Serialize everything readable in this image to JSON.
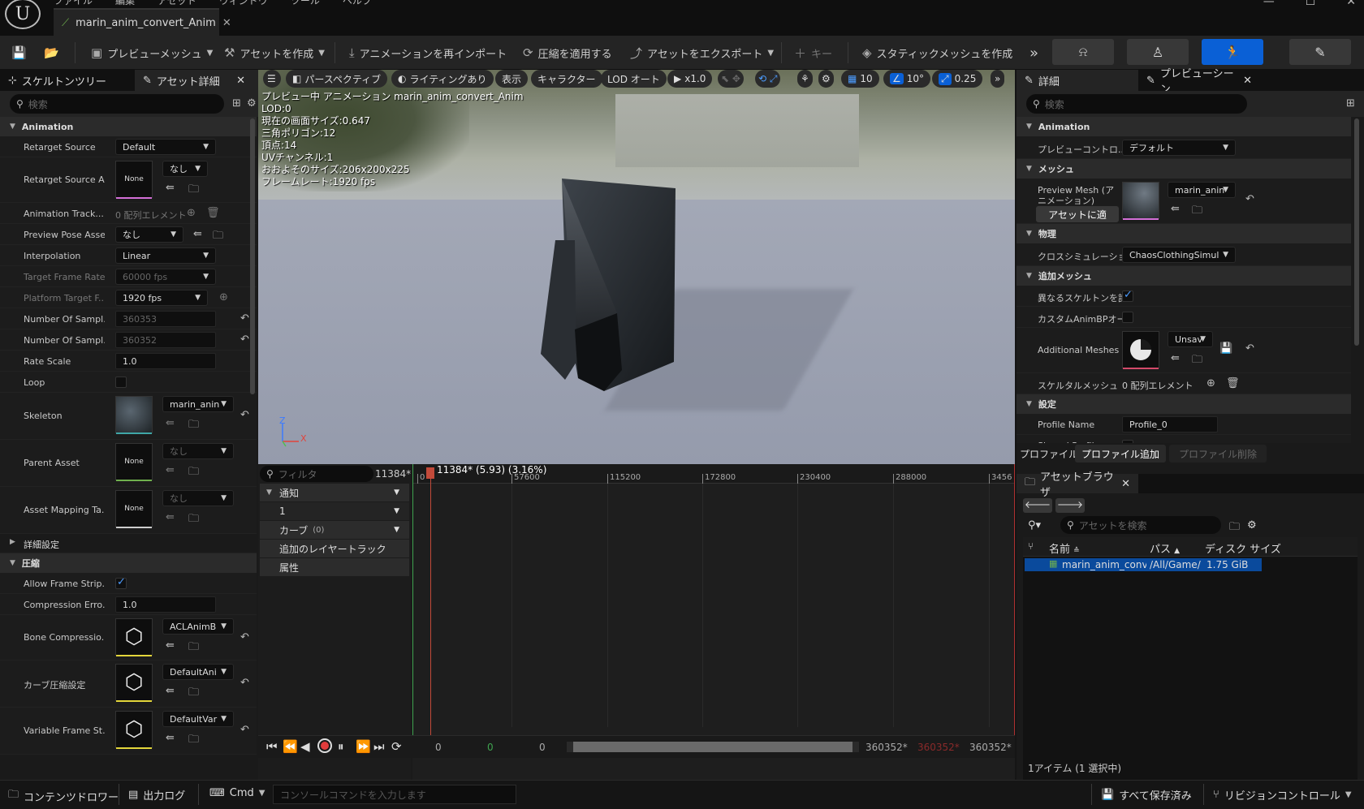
{
  "app": {
    "menu": [
      "ファイル",
      "編集",
      "アセット",
      "ウィンドウ",
      "ツール",
      "ヘルプ"
    ],
    "doc_tab": "marin_anim_convert_Anim"
  },
  "toolbar": {
    "preview_mesh": "プレビューメッシュ",
    "create_asset": "アセットを作成",
    "reimport": "アニメーションを再インポート",
    "apply_compression": "圧縮を適用する",
    "export_asset": "アセットをエクスポート",
    "key": "キー",
    "make_static_mesh": "スタティックメッシュを作成"
  },
  "left": {
    "tabs": [
      "スケルトンツリー",
      "アセット詳細"
    ],
    "search_placeholder": "検索",
    "sections": {
      "animation": "Animation",
      "advanced": "詳細設定",
      "compression": "圧縮"
    },
    "props": {
      "retarget_source": {
        "label": "Retarget Source",
        "value": "Default"
      },
      "retarget_source_asset": {
        "label": "Retarget Source A...",
        "thumb": "None",
        "value": "なし"
      },
      "animation_track": {
        "label": "Animation Track...",
        "value": "0 配列エレメント"
      },
      "preview_pose": {
        "label": "Preview Pose Asset",
        "value": "なし"
      },
      "interpolation": {
        "label": "Interpolation",
        "value": "Linear"
      },
      "target_frame_rate": {
        "label": "Target Frame Rate",
        "value": "60000 fps"
      },
      "platform_target": {
        "label": "Platform Target F...",
        "value": "1920 fps"
      },
      "num_samples_a": {
        "label": "Number Of Sampl...",
        "value": "360353"
      },
      "num_samples_b": {
        "label": "Number Of Sampl...",
        "value": "360352"
      },
      "rate_scale": {
        "label": "Rate Scale",
        "value": "1.0"
      },
      "loop": {
        "label": "Loop"
      },
      "skeleton": {
        "label": "Skeleton",
        "value": "marin_anin"
      },
      "parent_asset": {
        "label": "Parent Asset",
        "thumb": "None",
        "value": "なし"
      },
      "asset_mapping": {
        "label": "Asset Mapping Ta...",
        "thumb": "None",
        "value": "なし"
      },
      "allow_frame_strip": {
        "label": "Allow Frame Strip..."
      },
      "compression_error": {
        "label": "Compression Erro...",
        "value": "1.0"
      },
      "bone_compression": {
        "label": "Bone Compressio...",
        "value": "ACLAnimB"
      },
      "curve_compression": {
        "label": "カーブ圧縮設定",
        "value": "DefaultAni"
      },
      "variable_frame": {
        "label": "Variable Frame St...",
        "value": "DefaultVar"
      }
    }
  },
  "viewport": {
    "buttons": [
      "パースペクティブ",
      "ライティングあり",
      "表示",
      "キャラクター",
      "LOD オート",
      "x1.0",
      "10",
      "10°",
      "0.25"
    ],
    "stats": [
      "プレビュー中 アニメーション marin_anim_convert_Anim",
      "LOD:0",
      "現在の画面サイズ:0.647",
      "三角ポリゴン:12",
      "頂点:14",
      "UVチャンネル:1",
      "おおよそのサイズ:206x200x225",
      "フレームレート:1920 fps"
    ],
    "axis_z": "Z",
    "axis_x": "X"
  },
  "right": {
    "tabs": [
      "詳細",
      "プレビューシーン..."
    ],
    "search_placeholder": "検索",
    "sections": {
      "animation": "Animation",
      "mesh": "メッシュ",
      "physics": "物理",
      "additional": "追加メッシュ",
      "settings": "設定"
    },
    "props": {
      "preview_controller": {
        "label": "プレビューコントロ...",
        "value": "デフォルト"
      },
      "preview_mesh": {
        "label": "Preview Mesh (アニメーション)",
        "value": "marin_anin",
        "apply": "アセットに適"
      },
      "cloth_sim": {
        "label": "クロスシミュレーション",
        "value": "ChaosClothingSimul"
      },
      "diff_skeleton": {
        "label": "異なるスケルトンを許"
      },
      "custom_anim_bp": {
        "label": "カスタムAnimBPオー"
      },
      "additional_meshes": {
        "label": "Additional Meshes",
        "value": "Unsav"
      },
      "skeletal_mesh": {
        "label": "スケルタルメッシュ",
        "value": "0 配列エレメント"
      },
      "profile_name": {
        "label": "Profile Name",
        "value": "Profile_0"
      },
      "shared_profile": {
        "label": "Shared Profile"
      }
    },
    "profile_bar": [
      "プロファイル",
      "プロファイル追加",
      "プロファイル削除"
    ]
  },
  "sequencer": {
    "filter_placeholder": "フィルタ",
    "frame": "11384*",
    "tracks": [
      "通知",
      "1",
      "カーブ",
      "追加のレイヤートラック",
      "属性"
    ],
    "curve_count": "(0)",
    "playhead_label": "11384* (5.93) (3.16%)",
    "ticks": [
      "0",
      "57600",
      "115200",
      "172800",
      "230400",
      "288000",
      "3456"
    ],
    "bottom": {
      "a": "0",
      "b": "0",
      "c": "0",
      "end1": "360352*",
      "end2": "360352*",
      "end3": "360352*"
    }
  },
  "assets": {
    "title": "アセットブラウザ",
    "search_placeholder": "アセットを検索",
    "columns": [
      "名前",
      "パス",
      "ディスク サイズ"
    ],
    "rows": [
      {
        "name": "marin_anim_conve",
        "path": "/All/Game/",
        "size": "1.75 GiB"
      }
    ],
    "footer": "1アイテム (1 選択中)"
  },
  "status": {
    "content_drawer": "コンテンツドロワー",
    "output_log": "出力ログ",
    "cmd": "Cmd",
    "console_placeholder": "コンソールコマンドを入力します",
    "save_all": "すべて保存済み",
    "revision": "リビジョンコントロール"
  }
}
